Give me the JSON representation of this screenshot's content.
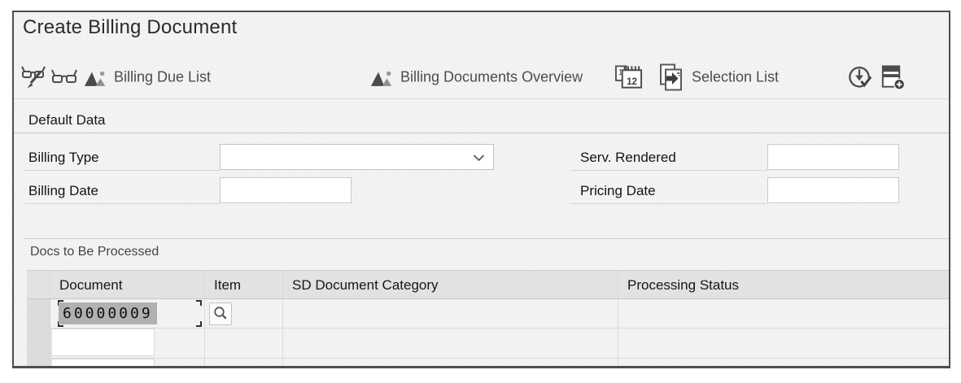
{
  "window": {
    "title": "Create Billing Document"
  },
  "toolbar": {
    "buttons": [
      {
        "icon": "glasses-pencil-icon",
        "label": ""
      },
      {
        "icon": "glasses-icon",
        "label": ""
      },
      {
        "icon": "analysis-icon",
        "label": "Billing Due List"
      },
      {
        "icon": "analysis-icon",
        "label": "Billing Documents Overview"
      },
      {
        "icon": "billing-calendar-icon",
        "label": "",
        "glyph_top": "1",
        "glyph_bottom": "12"
      },
      {
        "icon": "document-arrow-icon",
        "label": "Selection List"
      },
      {
        "icon": "circle-arrow-check-icon",
        "label": ""
      },
      {
        "icon": "list-add-icon",
        "label": ""
      }
    ]
  },
  "default_data": {
    "title": "Default Data",
    "billing_type_label": "Billing Type",
    "billing_type_value": "",
    "serv_rendered_label": "Serv. Rendered",
    "serv_rendered_value": "",
    "billing_date_label": "Billing Date",
    "billing_date_value": "",
    "pricing_date_label": "Pricing Date",
    "pricing_date_value": ""
  },
  "docs": {
    "title": "Docs to Be Processed",
    "columns": [
      "Document",
      "Item",
      "SD Document Category",
      "Processing Status"
    ],
    "rows": [
      {
        "document": "60000009",
        "item": "",
        "sd_document_category": "",
        "processing_status": ""
      },
      {
        "document": "",
        "item": "",
        "sd_document_category": "",
        "processing_status": ""
      }
    ]
  },
  "colors": {
    "window_border": "#4e4e4e",
    "background": "#f3f3f2",
    "selection_highlight": "#b1b1b0",
    "table_header": "#e2e2e1",
    "icon_gray": "#4c4c4c"
  }
}
